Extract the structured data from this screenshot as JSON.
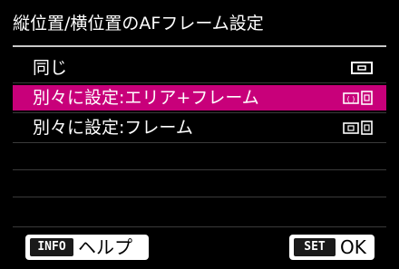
{
  "title": "縦位置/横位置のAFフレーム設定",
  "options": [
    {
      "label": "同じ",
      "icon": "single-frame-icon",
      "selected": false
    },
    {
      "label": "別々に設定:エリア+フレーム",
      "icon": "area-frame-separate-icon",
      "selected": true
    },
    {
      "label": "別々に設定:フレーム",
      "icon": "frame-separate-icon",
      "selected": false
    }
  ],
  "footer": {
    "help_key": "INFO",
    "help_label": "ヘルプ",
    "ok_key": "SET",
    "ok_label": "OK"
  },
  "colors": {
    "background": "#000000",
    "highlight": "#c8007a",
    "text": "#ffffff"
  }
}
